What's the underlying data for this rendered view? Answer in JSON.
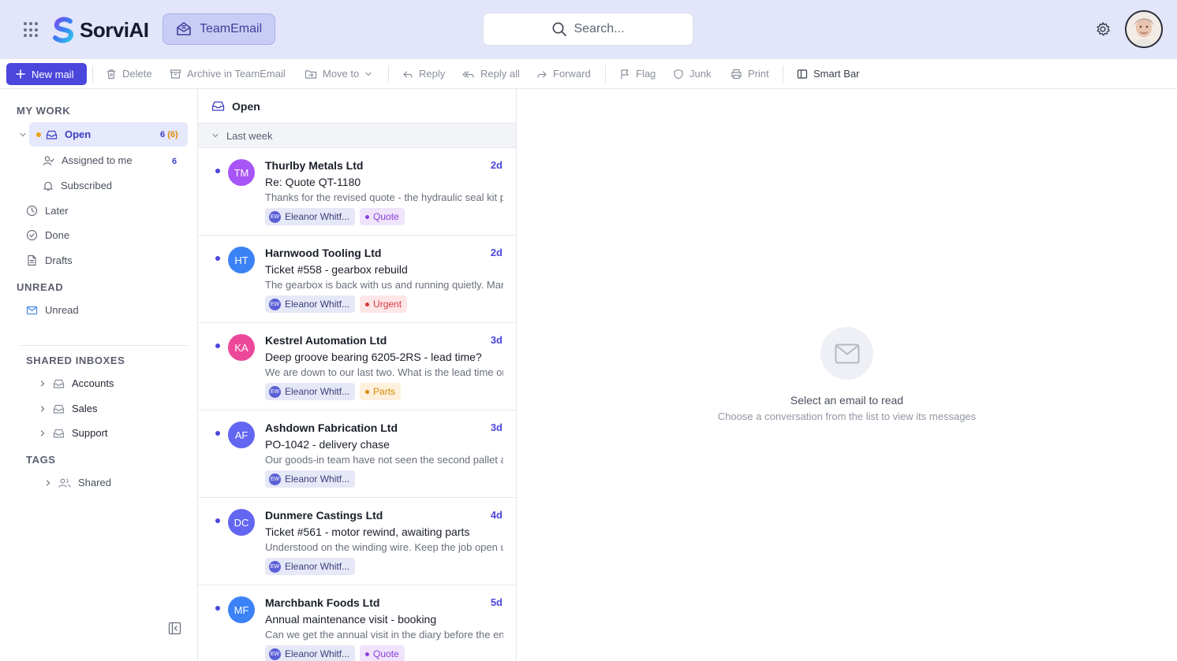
{
  "topbar": {
    "logo_text": "SorviAI",
    "app_name": "TeamEmail",
    "search_placeholder": "Search..."
  },
  "toolbar": {
    "new_mail": "New mail",
    "delete": "Delete",
    "archive": "Archive in TeamEmail",
    "move_to": "Move to",
    "reply": "Reply",
    "reply_all": "Reply all",
    "forward": "Forward",
    "flag": "Flag",
    "junk": "Junk",
    "print": "Print",
    "smart_bar": "Smart Bar"
  },
  "sidebar": {
    "my_work_title": "MY WORK",
    "open": {
      "label": "Open",
      "count": "6",
      "count_paren": "(6)"
    },
    "assigned": {
      "label": "Assigned to me",
      "count": "6"
    },
    "subscribed": "Subscribed",
    "later": "Later",
    "done": "Done",
    "drafts": "Drafts",
    "unread_title": "UNREAD",
    "unread": "Unread",
    "shared_title": "SHARED INBOXES",
    "shared": [
      "Accounts",
      "Sales",
      "Support"
    ],
    "tags_title": "TAGS",
    "tags_shared": "Shared"
  },
  "list": {
    "title": "Open",
    "group": "Last week",
    "mails": [
      {
        "initials": "TM",
        "color": "#a855f7",
        "sender": "Thurlby Metals Ltd",
        "age": "2d",
        "subject": "Re: Quote QT-1180",
        "preview": "Thanks for the revised quote - the hydraulic seal kit price is fine for us.",
        "assignee": "Eleanor Whitf...",
        "assignee_initials": "EW",
        "tag": "Quote",
        "tag_fg": "#8b3fd9",
        "tag_bg": "#efe4fb"
      },
      {
        "initials": "HT",
        "color": "#3b82f6",
        "sender": "Harnwood Tooling Ltd",
        "age": "2d",
        "subject": "Ticket #558 - gearbox rebuild",
        "preview": "The gearbox is back with us and running quietly. Many thanks.",
        "assignee": "Eleanor Whitf...",
        "assignee_initials": "EW",
        "tag": "Urgent",
        "tag_fg": "#d9363e",
        "tag_bg": "#fde6e7"
      },
      {
        "initials": "KA",
        "color": "#ec4899",
        "sender": "Kestrel Automation Ltd",
        "age": "3d",
        "subject": "Deep groove bearing 6205-2RS - lead time?",
        "preview": "We are down to our last two. What is the lead time on another box?",
        "assignee": "Eleanor Whitf...",
        "assignee_initials": "EW",
        "tag": "Parts",
        "tag_fg": "#d98a00",
        "tag_bg": "#fdf0dc"
      },
      {
        "initials": "AF",
        "color": "#6366f1",
        "sender": "Ashdown Fabrication Ltd",
        "age": "3d",
        "subject": "PO-1042 - delivery chase",
        "preview": "Our goods-in team have not seen the second pallet arrive yet.",
        "assignee": "Eleanor Whitf...",
        "assignee_initials": "EW",
        "tag": "",
        "tag_fg": "",
        "tag_bg": ""
      },
      {
        "initials": "DC",
        "color": "#6366f1",
        "sender": "Dunmere Castings Ltd",
        "age": "4d",
        "subject": "Ticket #561 - motor rewind, awaiting parts",
        "preview": "Understood on the winding wire. Keep the job open until it arrives.",
        "assignee": "Eleanor Whitf...",
        "assignee_initials": "EW",
        "tag": "",
        "tag_fg": "",
        "tag_bg": ""
      },
      {
        "initials": "MF",
        "color": "#3b82f6",
        "sender": "Marchbank Foods Ltd",
        "age": "5d",
        "subject": "Annual maintenance visit - booking",
        "preview": "Can we get the annual visit in the diary before the end of the month?",
        "assignee": "Eleanor Whitf...",
        "assignee_initials": "EW",
        "tag": "Quote",
        "tag_fg": "#8b3fd9",
        "tag_bg": "#efe4fb"
      }
    ]
  },
  "pane": {
    "empty_title": "Select an email to read",
    "empty_subtitle": "Choose a conversation from the list to view its messages"
  }
}
